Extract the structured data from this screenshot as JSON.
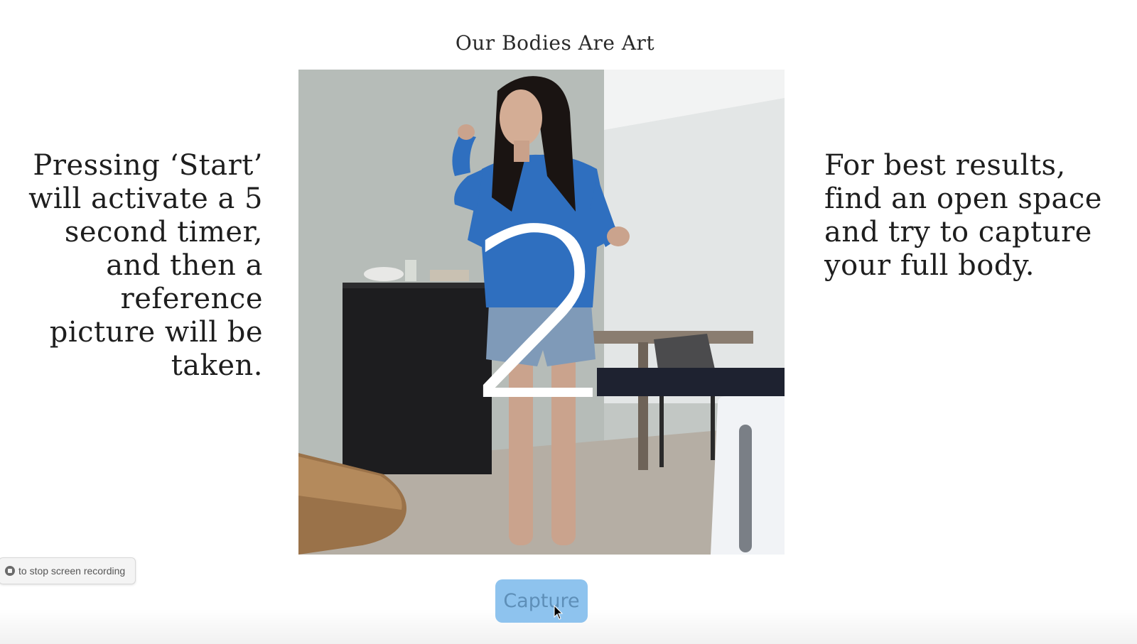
{
  "page": {
    "title": "Our Bodies Are Art"
  },
  "instructions": {
    "left": "Pressing ‘Start’ will activate a 5 second timer, and then a reference picture will be taken.",
    "right": "For best results, find an open space and try to capture your full body."
  },
  "camera": {
    "countdown": "2"
  },
  "controls": {
    "capture_label": "Capture"
  },
  "system": {
    "recording_hint": "to stop screen recording"
  },
  "colors": {
    "button_bg": "#8ec3ee",
    "button_text": "#5e8fb8",
    "shirt": "#2f6fbf"
  },
  "icons": {
    "stop_recording": "stop-recording-icon",
    "cursor": "mouse-cursor-icon"
  }
}
